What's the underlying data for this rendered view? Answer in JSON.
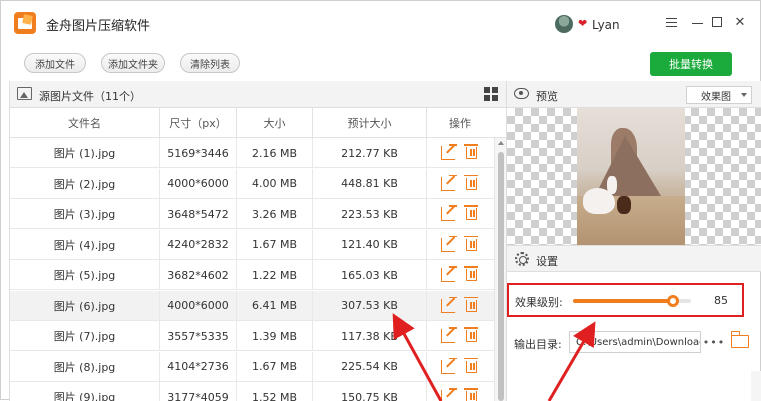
{
  "app": {
    "title": "金舟图片压缩软件",
    "user": "Lyan"
  },
  "toolbar": {
    "add_file": "添加文件",
    "add_folder": "添加文件夹",
    "clear_list": "清除列表",
    "batch_convert": "批量转换"
  },
  "file_panel": {
    "header": "源图片文件（11个）",
    "columns": [
      "文件名",
      "尺寸（px）",
      "大小",
      "预计大小",
      "操作"
    ],
    "rows": [
      {
        "name": "图片 (1).jpg",
        "size_px": "5169*3446",
        "size": "2.16 MB",
        "est": "212.77 KB"
      },
      {
        "name": "图片 (2).jpg",
        "size_px": "4000*6000",
        "size": "4.00 MB",
        "est": "448.81 KB"
      },
      {
        "name": "图片 (3).jpg",
        "size_px": "3648*5472",
        "size": "3.26 MB",
        "est": "223.53 KB"
      },
      {
        "name": "图片 (4).jpg",
        "size_px": "4240*2832",
        "size": "1.67 MB",
        "est": "121.40 KB"
      },
      {
        "name": "图片 (5).jpg",
        "size_px": "3682*4602",
        "size": "1.22 MB",
        "est": "165.03 KB"
      },
      {
        "name": "图片 (6).jpg",
        "size_px": "4000*6000",
        "size": "6.41 MB",
        "est": "307.53 KB"
      },
      {
        "name": "图片 (7).jpg",
        "size_px": "3557*5335",
        "size": "1.39 MB",
        "est": "117.38 KB"
      },
      {
        "name": "图片 (8).jpg",
        "size_px": "4104*2736",
        "size": "1.67 MB",
        "est": "225.54 KB"
      },
      {
        "name": "图片 (9).jpg",
        "size_px": "3177*4059",
        "size": "1.52 MB",
        "est": "150.75 KB"
      }
    ],
    "selected_row": 5
  },
  "preview_panel": {
    "header": "预览",
    "view_mode": "效果图"
  },
  "settings": {
    "header": "设置",
    "level_label": "效果级别:",
    "level_value": "85",
    "level_percent": 85,
    "output_label": "输出目录:",
    "output_path": "C:\\Users\\admin\\Downloads",
    "browse_label": "•••"
  },
  "colors": {
    "accent": "#f07d1e",
    "convert_green": "#1aab3c",
    "annotation_red": "#e02020"
  }
}
